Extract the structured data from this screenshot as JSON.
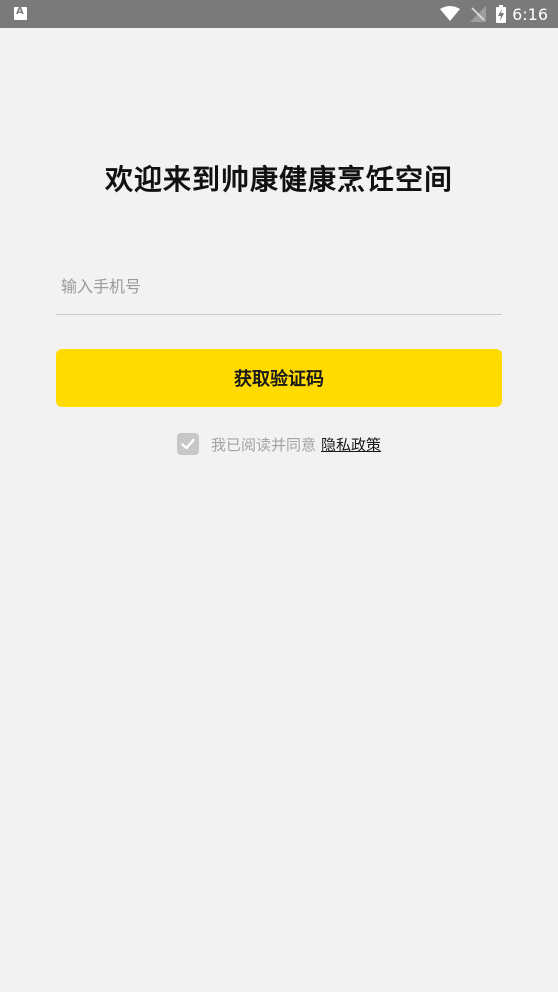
{
  "status_bar": {
    "time": "6:16",
    "notification_icon": "a-app-icon",
    "icons": [
      "wifi-icon",
      "signal-off-icon",
      "battery-charging-icon"
    ]
  },
  "welcome": {
    "title": "欢迎来到帅康健康烹饪空间"
  },
  "login": {
    "phone_placeholder": "输入手机号",
    "phone_value": "",
    "get_code_label": "获取验证码"
  },
  "agreement": {
    "checked": true,
    "text": "我已阅读并同意",
    "link": "隐私政策"
  },
  "colors": {
    "accent": "#ffdb00",
    "background": "#f2f2f2",
    "status_bar": "#7a7a7a"
  }
}
